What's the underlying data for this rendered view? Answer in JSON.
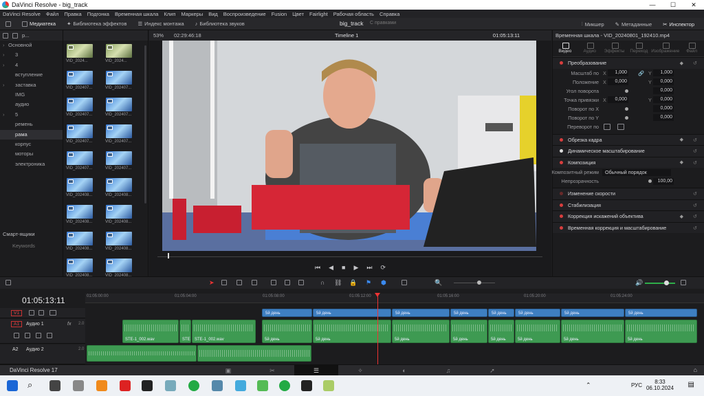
{
  "window": {
    "title": "DaVinci Resolve - big_track",
    "controls": [
      "—",
      "☐",
      "✕"
    ]
  },
  "menu": [
    "DaVinci Resolve",
    "Файл",
    "Правка",
    "Подгонка",
    "Временная шкала",
    "Клип",
    "Маркеры",
    "Вид",
    "Воспроизведение",
    "Fusion",
    "Цвет",
    "Fairlight",
    "Рабочая область",
    "Справка"
  ],
  "toolbar": {
    "media_pool": "Медиатека",
    "effects_library": "Библиотека эффектов",
    "edit_index": "Индекс монтажа",
    "sound_library": "Библиотека звуков",
    "project_name": "big_track",
    "project_status": "С правками",
    "mixer": "Микшер",
    "metadata": "Метаданные",
    "inspector": "Инспектор"
  },
  "bins": {
    "header": "р...",
    "items": [
      {
        "label": "Основной",
        "arrow": true
      },
      {
        "label": "3",
        "arrow": true
      },
      {
        "label": "4",
        "arrow": true
      },
      {
        "label": "вступление",
        "arrow": false
      },
      {
        "label": "заставка",
        "arrow": true
      },
      {
        "label": "IMG",
        "arrow": false
      },
      {
        "label": "аудио",
        "arrow": false
      },
      {
        "label": "5",
        "arrow": true
      },
      {
        "label": "ремень",
        "arrow": false
      },
      {
        "label": "рама",
        "arrow": false,
        "selected": true
      },
      {
        "label": "корпус",
        "arrow": false
      },
      {
        "label": "моторы",
        "arrow": false
      },
      {
        "label": "электроника",
        "arrow": false
      }
    ],
    "smart_bins": "Смарт-ящики",
    "keywords": "Keywords"
  },
  "media_pool": {
    "clips": [
      "VID_2024...",
      "VID_2024...",
      "VID_202407...",
      "VID_202407...",
      "VID_202407...",
      "VID_202407...",
      "VID_202407...",
      "VID_202407...",
      "VID_202407...",
      "VID_202407...",
      "VID_202408...",
      "VID_202408...",
      "VID_202408...",
      "VID_202408...",
      "VID_202408...",
      "VID_202408...",
      "VID_202408...",
      "VID_202408...",
      "",
      ""
    ]
  },
  "viewer": {
    "zoom": "53%",
    "timecode_left": "02:29:46:18",
    "timeline_name": "Timeline 1",
    "timecode_right": "01:05:13:11"
  },
  "inspector": {
    "title": "Временная шкала - VID_20240801_192410.mp4",
    "tabs": [
      "Видео",
      "Аудио",
      "Эффекты",
      "Переход",
      "Изображение",
      "Файл"
    ],
    "transform": "Преобразование",
    "props": {
      "zoom_label": "Масштаб по",
      "zoom_x": "1,000",
      "zoom_y": "1,000",
      "position_label": "Положение",
      "pos_x": "0,000",
      "pos_y": "0,000",
      "rotation_label": "Угол поворота",
      "rotation": "0,000",
      "anchor_label": "Точка привязки",
      "anchor_x": "0,000",
      "anchor_y": "0,000",
      "pitch_label": "Поворот по X",
      "pitch": "0,000",
      "yaw_label": "Поворот по Y",
      "yaw": "0,000",
      "flip_label": "Переворот по"
    },
    "axis_x": "X",
    "axis_y": "Y",
    "sections": {
      "crop": "Обрезка кадра",
      "dynamic_zoom": "Динамическое масштабирование",
      "composite": "Композиция",
      "composite_mode_label": "Композитный режим",
      "composite_mode": "Обычный порядок",
      "opacity_label": "Непрозрачность",
      "opacity": "100,00",
      "speed": "Изменение скорости",
      "stabilization": "Стабилизация",
      "lens": "Коррекция искажений объектива",
      "retime": "Временная коррекция и масштабирование"
    }
  },
  "timeline": {
    "timecode": "01:05:13:11",
    "ruler": [
      "01:05:00:00",
      "01:05:04:00",
      "01:05:08:00",
      "01:05:12:00",
      "01:05:16:00",
      "01:05:20:00",
      "01:05:24:00"
    ],
    "tracks": {
      "v1": "V1",
      "a1": "A1",
      "a1_name": "Аудио 1",
      "a1_fx": "fx",
      "a1_ch": "2.0",
      "a2": "A2",
      "a2_name": "Аудио 2",
      "a2_ch": "2.0"
    },
    "video_clip_label": "5й день",
    "audio_labels": [
      "STE-1_002.wav",
      "STE",
      "STE-1_002.wav",
      "5й день"
    ]
  },
  "statusbar": {
    "app_name": "DaVinci Resolve 17"
  },
  "taskbar": {
    "lang": "РУС",
    "time": "8:33",
    "date": "06.10.2024"
  }
}
